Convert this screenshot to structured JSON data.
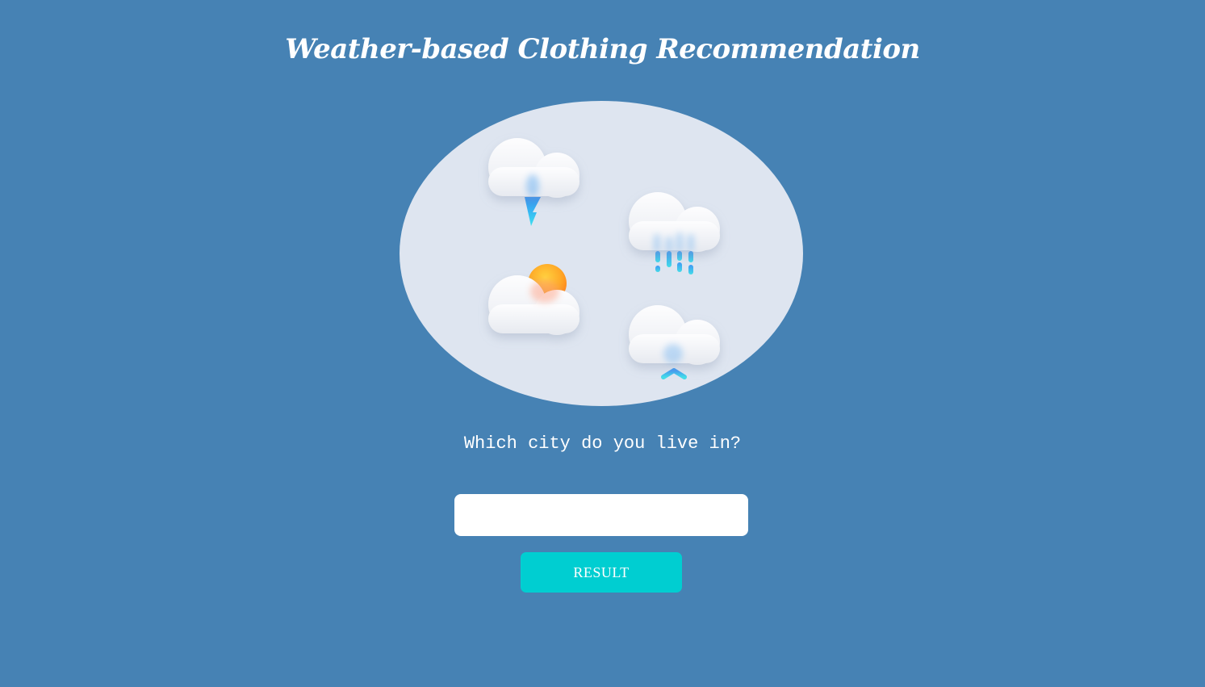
{
  "header": {
    "title": "Weather-based Clothing Recommendation"
  },
  "illustration": {
    "icons": [
      "thunderstorm-cloud-icon",
      "rain-cloud-icon",
      "partly-sunny-cloud-icon",
      "snow-cloud-icon"
    ],
    "background_color": "#dee5f0"
  },
  "form": {
    "question": "Which city do you live in?",
    "city_value": "",
    "city_placeholder": "",
    "submit_label": "RESULT"
  },
  "colors": {
    "page_background": "#4682b4",
    "button_background": "#00ced1",
    "text": "#ffffff"
  }
}
